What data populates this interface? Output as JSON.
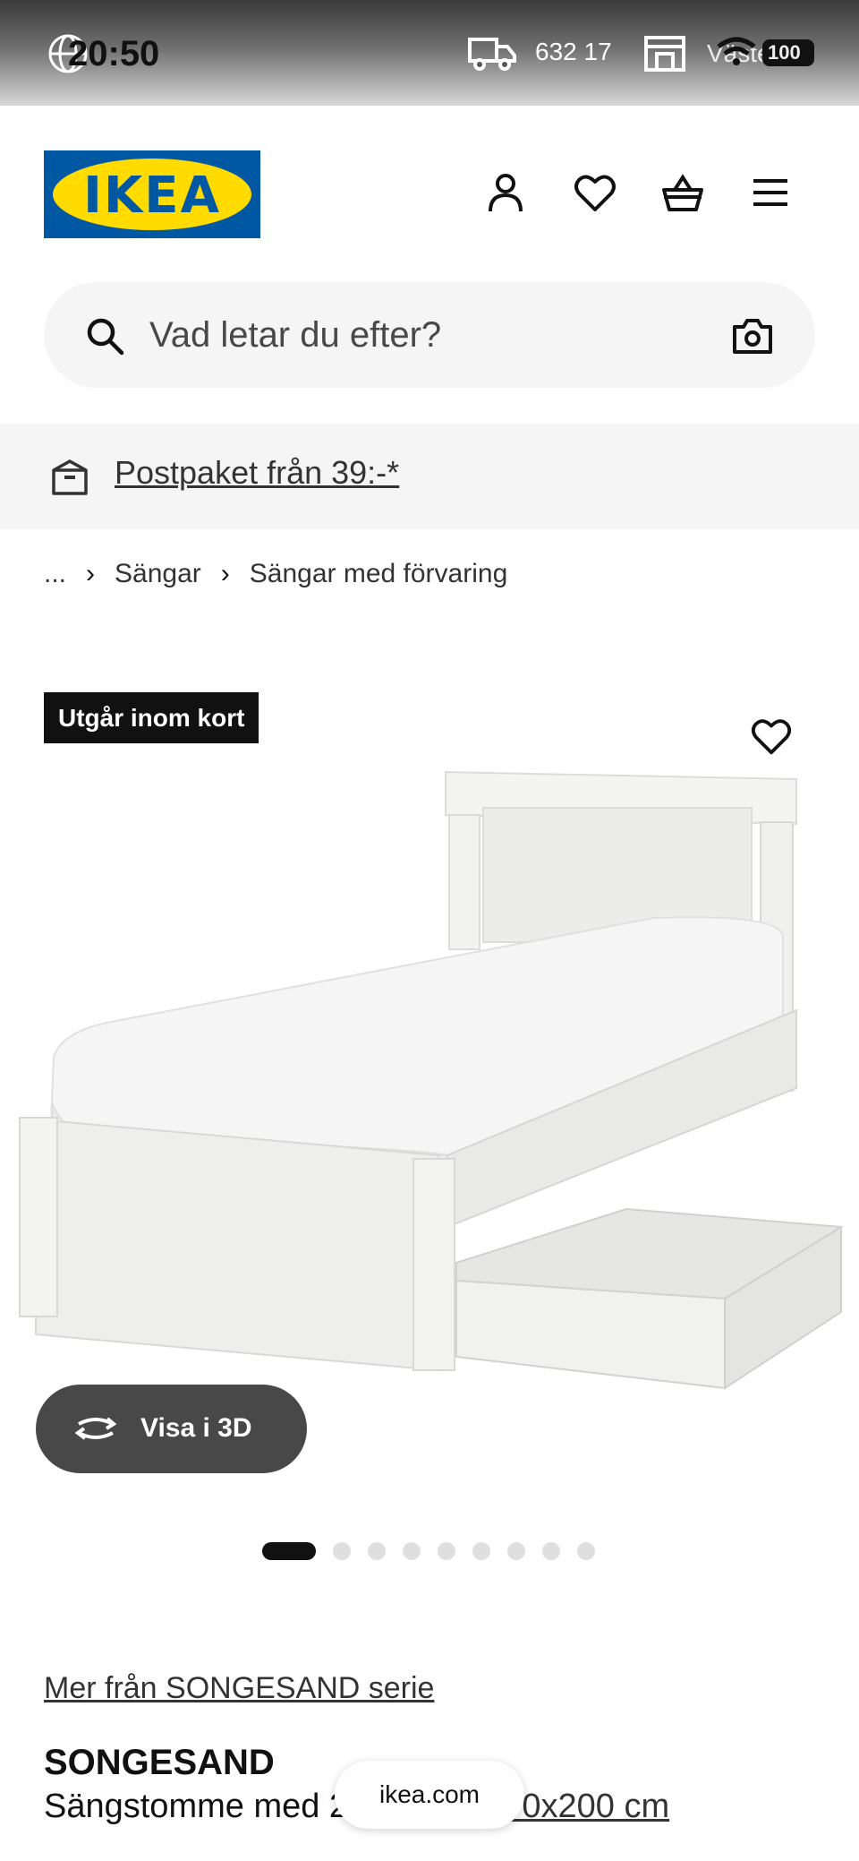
{
  "status_bar": {
    "time": "20:50",
    "postal_code": "632 17",
    "location": "Västerås",
    "battery": "100"
  },
  "header": {
    "logo_text": "IKEA",
    "icons": [
      "account-icon",
      "favorites-icon",
      "cart-icon",
      "menu-icon"
    ]
  },
  "search": {
    "placeholder": "Vad letar du efter?"
  },
  "promo": {
    "text": "Postpaket från 39:-*"
  },
  "breadcrumb": {
    "ellipsis": "...",
    "items": [
      "Sängar",
      "Sängar med förvaring"
    ]
  },
  "product": {
    "badge": "Utgår inom kort",
    "view_3d_label": "Visa i 3D",
    "image_count": 9,
    "active_image": 1,
    "series_link": "Mer från SONGESAND serie",
    "name": "SONGESAND",
    "description": "Sängstomme med 2 lådor, vit,",
    "size": "90x200 cm"
  },
  "browser": {
    "url": "ikea.com"
  },
  "colors": {
    "ikea_blue": "#0058a3",
    "ikea_yellow": "#ffdb00",
    "badge_bg": "#111111",
    "button_3d_bg": "#484848"
  }
}
